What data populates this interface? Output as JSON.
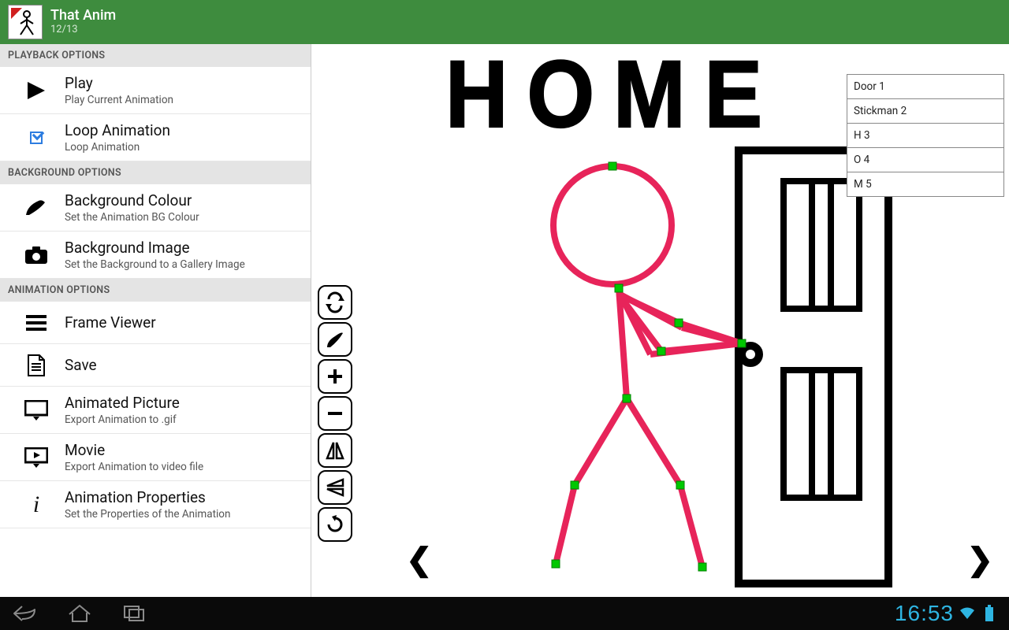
{
  "header": {
    "title": "That Anim",
    "frame_counter": "12/13"
  },
  "sidebar": {
    "sections": {
      "playback": {
        "header": "PLAYBACK OPTIONS"
      },
      "background": {
        "header": "BACKGROUND OPTIONS"
      },
      "animation": {
        "header": "ANIMATION OPTIONS"
      }
    },
    "play": {
      "title": "Play",
      "subtitle": "Play Current Animation"
    },
    "loop": {
      "title": "Loop Animation",
      "subtitle": "Loop Animation",
      "checked": true
    },
    "bgcolour": {
      "title": "Background Colour",
      "subtitle": "Set the Animation BG Colour"
    },
    "bgimage": {
      "title": "Background Image",
      "subtitle": "Set the Background to a Gallery Image"
    },
    "frameviewer": {
      "title": "Frame Viewer"
    },
    "save": {
      "title": "Save"
    },
    "animpic": {
      "title": "Animated Picture",
      "subtitle": "Export Animation to .gif"
    },
    "movie": {
      "title": "Movie",
      "subtitle": "Export Animation to video file"
    },
    "animprops": {
      "title": "Animation Properties",
      "subtitle": "Set the Properties of the Animation"
    }
  },
  "canvas": {
    "title_text": "HOME",
    "tools": [
      "cycle",
      "brush",
      "plus",
      "minus",
      "flip-horizontal",
      "flip-vertical",
      "rotate"
    ]
  },
  "layers": [
    "Door 1",
    "Stickman 2",
    "H 3",
    "O 4",
    "M 5"
  ],
  "statusbar": {
    "time": "16:53"
  }
}
